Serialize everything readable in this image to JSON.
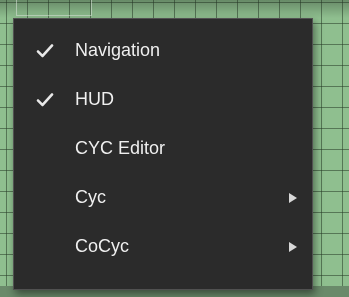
{
  "menu": {
    "items": [
      {
        "label": "Navigation",
        "checked": true,
        "submenu": false
      },
      {
        "label": "HUD",
        "checked": true,
        "submenu": false
      },
      {
        "label": "CYC Editor",
        "checked": false,
        "submenu": false
      },
      {
        "label": "Cyc",
        "checked": false,
        "submenu": true
      },
      {
        "label": "CoCyc",
        "checked": false,
        "submenu": true
      }
    ]
  },
  "icons": {
    "check": "checkmark-icon",
    "submenu": "submenu-arrow-icon"
  },
  "colors": {
    "menu_background": "#2b2b2b",
    "menu_border": "#515151",
    "text": "#f0f0f0",
    "viewport_grid": "#8fbf8f"
  }
}
